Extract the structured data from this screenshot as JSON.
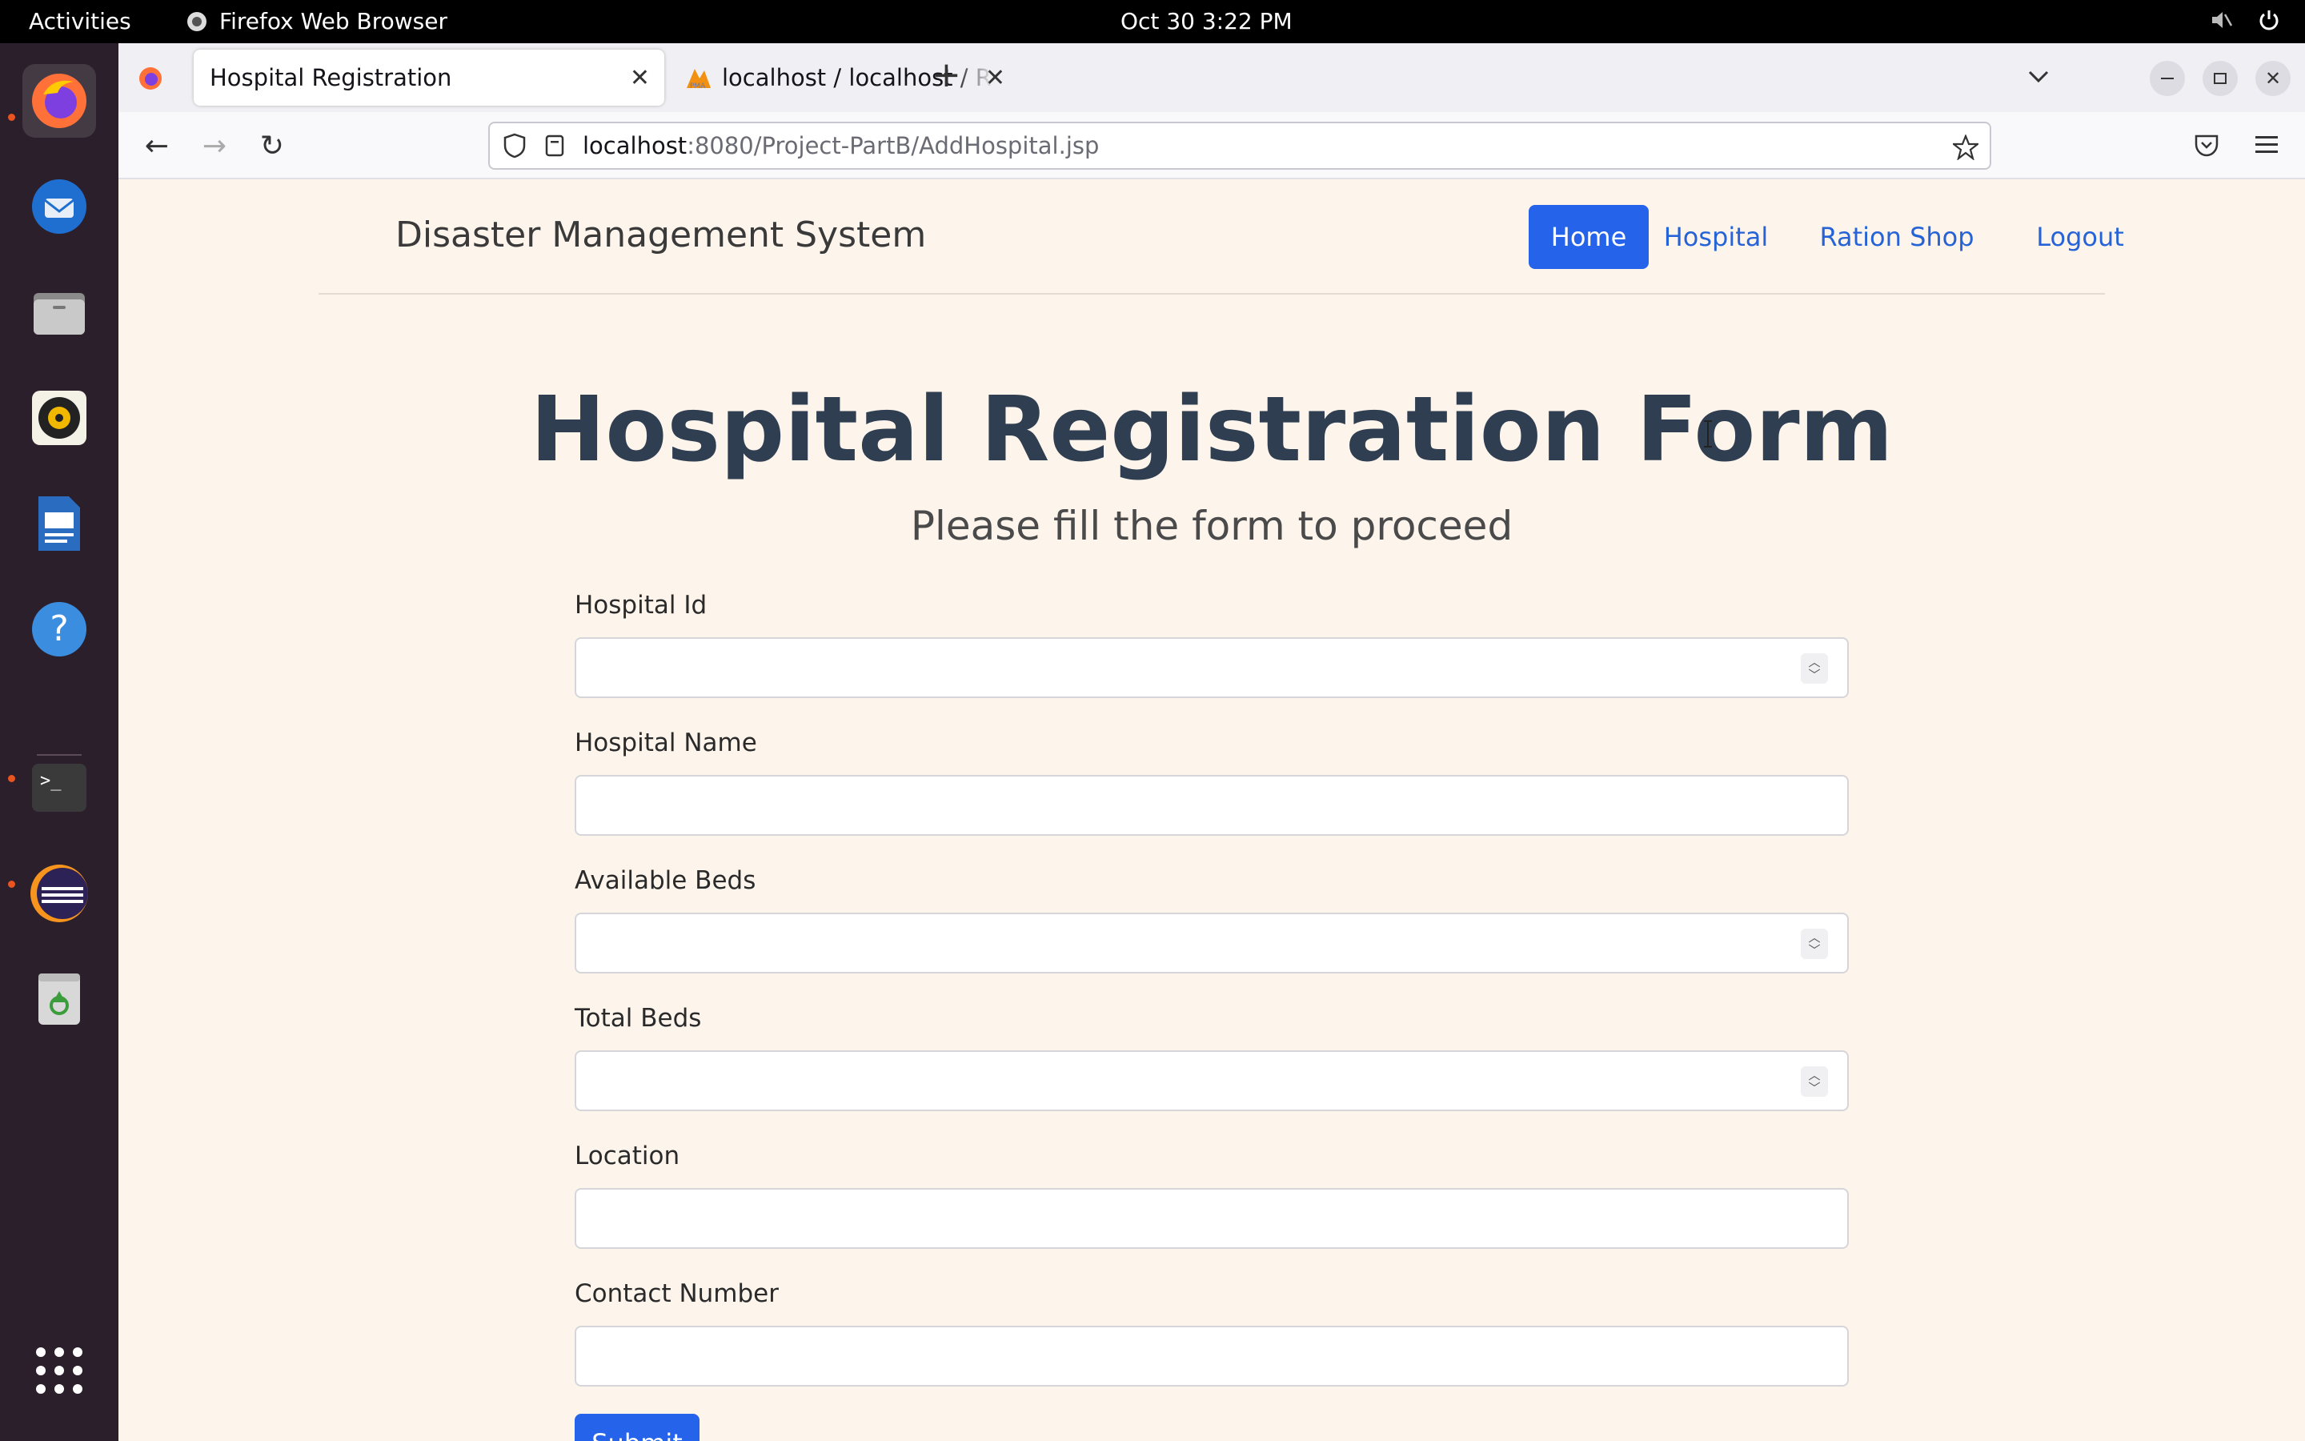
{
  "system_bar": {
    "activities": "Activities",
    "app_name": "Firefox Web Browser",
    "clock": "Oct 30   3:22 PM"
  },
  "dock": {
    "items": [
      "firefox-icon",
      "thunderbird-icon",
      "files-icon",
      "rhythmbox-icon",
      "writer-icon",
      "help-icon",
      "terminal-icon",
      "eclipse-icon",
      "trash-icon",
      "app-grid-icon"
    ]
  },
  "browser": {
    "tabs": [
      {
        "label": "Hospital Registration",
        "active": true
      },
      {
        "label": "localhost / localhost / Res",
        "active": false
      }
    ],
    "url_host": "localhost",
    "url_path": ":8080/Project-PartB/AddHospital.jsp"
  },
  "page": {
    "brand": "Disaster Management System",
    "nav": {
      "home": "Home",
      "hospital": "Hospital",
      "ration_shop": "Ration Shop",
      "logout": "Logout"
    },
    "title": "Hospital Registration Form",
    "subtitle": "Please fill the form to proceed",
    "fields": [
      {
        "label": "Hospital Id",
        "value": "",
        "type": "number"
      },
      {
        "label": "Hospital Name",
        "value": "",
        "type": "text"
      },
      {
        "label": "Available Beds",
        "value": "",
        "type": "number"
      },
      {
        "label": "Total Beds",
        "value": "",
        "type": "number"
      },
      {
        "label": "Location",
        "value": "",
        "type": "text"
      },
      {
        "label": "Contact Number",
        "value": "",
        "type": "text"
      }
    ],
    "submit_label": "Submit"
  },
  "colors": {
    "accent": "#2563eb",
    "page_background": "#fdf4ec",
    "heading": "#2f3e50"
  }
}
